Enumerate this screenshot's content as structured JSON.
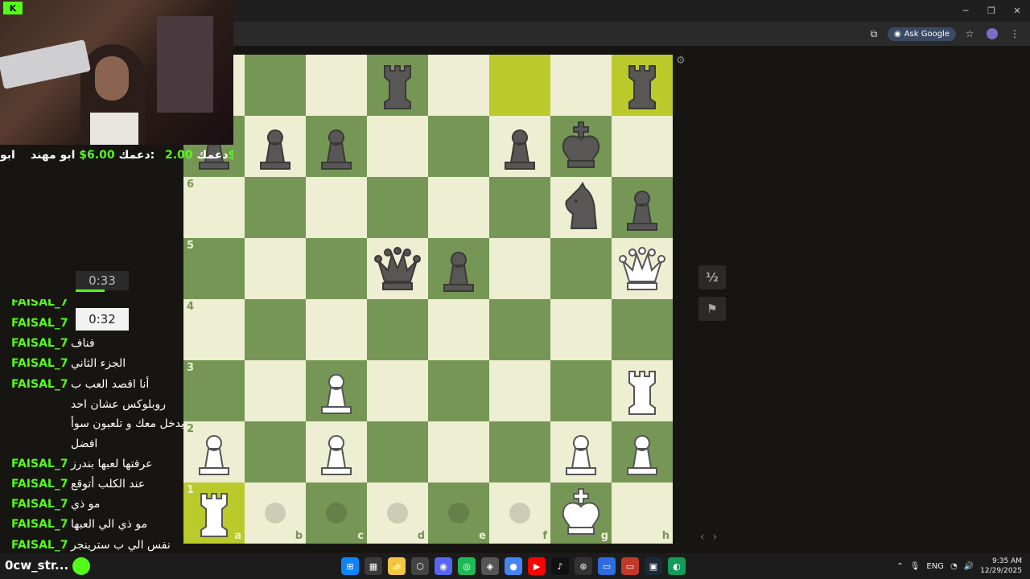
{
  "window": {
    "minimize": "─",
    "maximize": "❐",
    "close": "✕"
  },
  "toolbar": {
    "ask_google": "Ask Google",
    "star": "☆",
    "menu": "⋮",
    "cast": "⧉"
  },
  "board": {
    "rank_labels": {
      "6": "6",
      "5": "5",
      "4": "4",
      "3": "3",
      "2": "2",
      "1": "1"
    },
    "file_labels": [
      "a",
      "b",
      "c",
      "d",
      "e",
      "f",
      "g",
      "h"
    ],
    "squares": [
      [
        "",
        "",
        "",
        "bR",
        "",
        "hl",
        "",
        "bR hl"
      ],
      [
        "bP",
        "bP",
        "bP",
        "",
        "",
        "bP",
        "bK",
        ""
      ],
      [
        "",
        "",
        "",
        "",
        "",
        "",
        "bN",
        "bP"
      ],
      [
        "",
        "",
        "",
        "bQ",
        "bP",
        "",
        "",
        "wQ"
      ],
      [
        "",
        "",
        "",
        "",
        "",
        "",
        "",
        ""
      ],
      [
        "",
        "",
        "wP",
        "",
        "",
        "",
        "",
        "wR"
      ],
      [
        "wP",
        "",
        "wP",
        "",
        "",
        "",
        "wP",
        "wP"
      ],
      [
        "wR hl",
        "dot",
        "dot",
        "dot",
        "dot",
        "dot",
        "wK",
        ""
      ]
    ]
  },
  "side_buttons": {
    "draw": "½",
    "resign": "⚑",
    "prev": "‹",
    "next": "›",
    "gear": "⚙"
  },
  "stream": {
    "logo": "K",
    "ticker_1": "ابو",
    "ticker_2_name": "ابو مهند:",
    "ticker_2_amount": "6.00$",
    "ticker_2_suffix": "دعمك",
    "ticker_3_amount": "2.00$",
    "ticker_3_prefix": "دعمك",
    "timer_a": "0:33",
    "timer_b": "0:32"
  },
  "chat": [
    {
      "user": "FAISAL_7",
      "msg": ""
    },
    {
      "user": "FAISAL_7",
      "msg": ""
    },
    {
      "user": "FAISAL_7",
      "msg": "فناف"
    },
    {
      "user": "FAISAL_7",
      "msg": "الجزء الثاني"
    },
    {
      "user": "FAISAL_7",
      "msg": "أنا اقصد العب ب"
    },
    {
      "user": "",
      "msg": "روبلوكس عشان احد"
    },
    {
      "user": "",
      "msg": "يدخل معك و تلعبون سوأ"
    },
    {
      "user": "",
      "msg": "افضل"
    },
    {
      "user": "FAISAL_7",
      "msg": "عرفتها لعبها بندرز"
    },
    {
      "user": "FAISAL_7",
      "msg": "عند الكلب أتوقع"
    },
    {
      "user": "FAISAL_7",
      "msg": "مو ذي"
    },
    {
      "user": "FAISAL_7",
      "msg": "مو ذي الي العبها"
    },
    {
      "user": "FAISAL_7",
      "msg": "نفس الي ب سترينجر"
    }
  ],
  "taskbar": {
    "title": "0cw_str...",
    "apps": [
      "⊞",
      "▦",
      "📁",
      "⬡",
      "◉",
      "◎",
      "◈",
      "●",
      "▶",
      "♪",
      "⊛",
      "▭",
      "▭",
      "▣",
      "◐"
    ],
    "tray_lang": "ENG",
    "time": "9:35 AM",
    "date": "12/29/2025",
    "tray_up": "⌃",
    "tray_mic": "🎙",
    "tray_wifi": "◔",
    "tray_vol": "🔊"
  }
}
